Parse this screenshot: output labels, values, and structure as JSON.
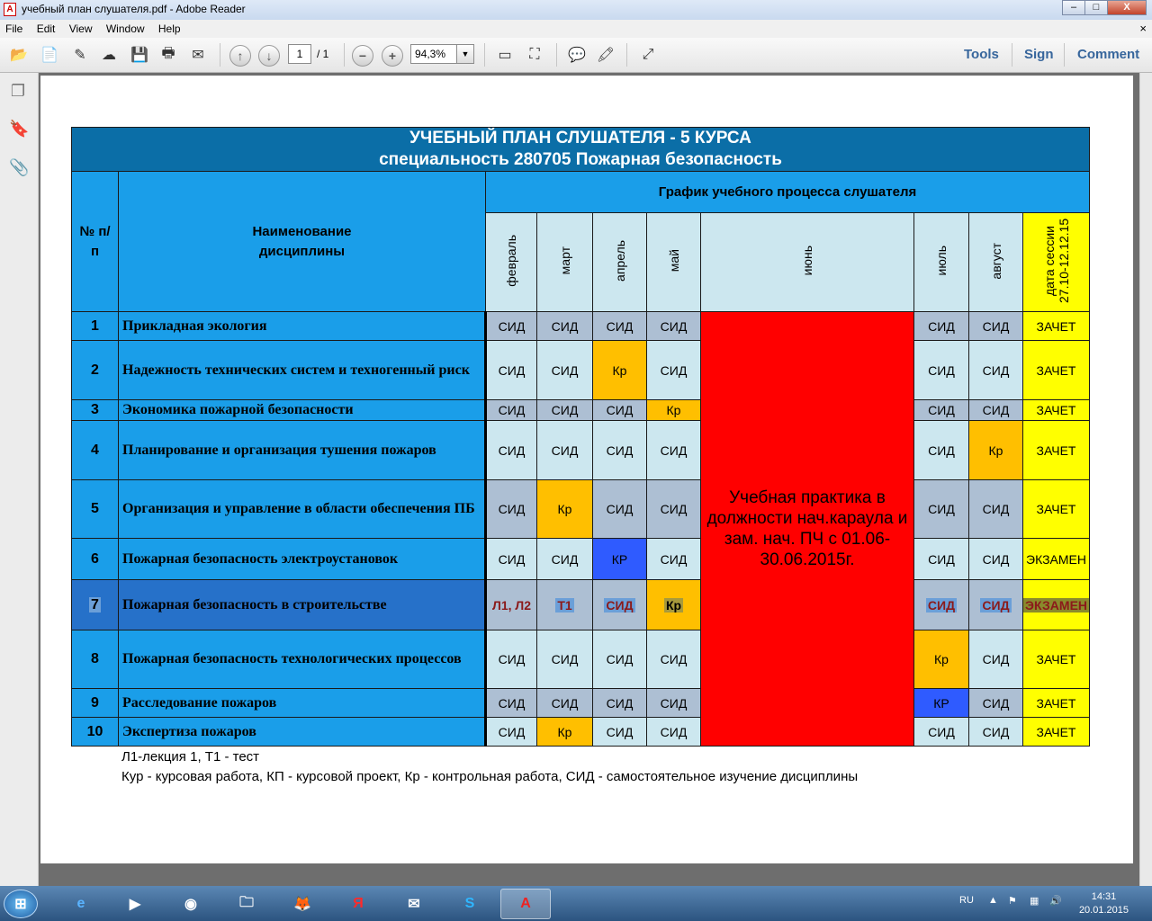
{
  "window": {
    "title": "учебный план слушателя.pdf - Adobe Reader",
    "buttons": {
      "minimize": "–",
      "maximize": "□",
      "close": "X"
    }
  },
  "menu": [
    "File",
    "Edit",
    "View",
    "Window",
    "Help"
  ],
  "menu_close": "×",
  "toolbar": {
    "page_current": "1",
    "page_total": "/ 1",
    "zoom": "94,3%",
    "tools_label": "Tools",
    "sign_label": "Sign",
    "comment_label": "Comment"
  },
  "table": {
    "title_line1": "УЧЕБНЫЙ ПЛАН СЛУШАТЕЛЯ - 5 КУРСА",
    "title_line2": "специальность 280705 Пожарная безопасность",
    "col_num": "№ п/п",
    "col_name": "Наименование дисциплины",
    "schedule_header": "График учебного процесса слушателя",
    "months": [
      "февраль",
      "март",
      "апрель",
      "май",
      "июнь",
      "июль",
      "август"
    ],
    "session_header": "дата сессии 27.10-12.12.15",
    "practice_text": "Учебная практика в должности нач.караула и зам. нач. ПЧ с 01.06-30.06.2015г.",
    "rows": [
      {
        "num": "1",
        "name": "Прикладная экология",
        "cells": [
          "СИД",
          "СИД",
          "СИД",
          "СИД",
          "СИД",
          "СИД"
        ],
        "session": "ЗАЧЕТ"
      },
      {
        "num": "2",
        "name": "Надежность технических систем и техногенный риск",
        "cells": [
          "СИД",
          "СИД",
          "Кр",
          "СИД",
          "СИД",
          "СИД"
        ],
        "session": "ЗАЧЕТ"
      },
      {
        "num": "3",
        "name": "Экономика пожарной безопасности",
        "cells": [
          "СИД",
          "СИД",
          "СИД",
          "Кр",
          "СИД",
          "СИД"
        ],
        "session": "ЗАЧЕТ"
      },
      {
        "num": "4",
        "name": "Планирование и организация тушения пожаров",
        "cells": [
          "СИД",
          "СИД",
          "СИД",
          "СИД",
          "СИД",
          "Кр"
        ],
        "session": "ЗАЧЕТ"
      },
      {
        "num": "5",
        "name": "Организация и управление в области обеспечения ПБ",
        "cells": [
          "СИД",
          "Кр",
          "СИД",
          "СИД",
          "СИД",
          "СИД"
        ],
        "session": "ЗАЧЕТ"
      },
      {
        "num": "6",
        "name": "Пожарная безопасность электроустановок",
        "cells": [
          "СИД",
          "СИД",
          "КР",
          "СИД",
          "СИД",
          "СИД"
        ],
        "session": "ЭКЗАМЕН"
      },
      {
        "num": "7",
        "name": "Пожарная безопасность в строительстве",
        "cells": [
          "Л1, Л2",
          "Т1",
          "СИД",
          "Кр",
          "СИД",
          "СИД"
        ],
        "session": "ЭКЗАМЕН"
      },
      {
        "num": "8",
        "name": "Пожарная безопасность технологических процессов",
        "cells": [
          "СИД",
          "СИД",
          "СИД",
          "СИД",
          "Кр",
          "СИД"
        ],
        "session": "ЗАЧЕТ"
      },
      {
        "num": "9",
        "name": "Расследование пожаров",
        "cells": [
          "СИД",
          "СИД",
          "СИД",
          "СИД",
          "КР",
          "СИД"
        ],
        "session": "ЗАЧЕТ"
      },
      {
        "num": "10",
        "name": "Экспертиза пожаров",
        "cells": [
          "СИД",
          "Кр",
          "СИД",
          "СИД",
          "СИД",
          "СИД"
        ],
        "session": "ЗАЧЕТ"
      }
    ]
  },
  "notes": [
    "Л1-лекция 1, Т1 - тест",
    "Кур - курсовая работа,  КП - курсовой проект, Кр - контрольная работа, СИД - самостоятельное изучение дисциплины"
  ],
  "taskbar": {
    "lang": "RU",
    "time": "14:31",
    "date": "20.01.2015"
  },
  "colors": {
    "header_dark": "#0b6ea7",
    "header_blue": "#1a9ee9",
    "cell_gray": "#adbfd3",
    "cell_light": "#cce7ef",
    "kr_orange": "#ffbf00",
    "kr_blue": "#2f5bff",
    "session_yellow": "#ffff00",
    "practice_red": "#ff0000"
  }
}
